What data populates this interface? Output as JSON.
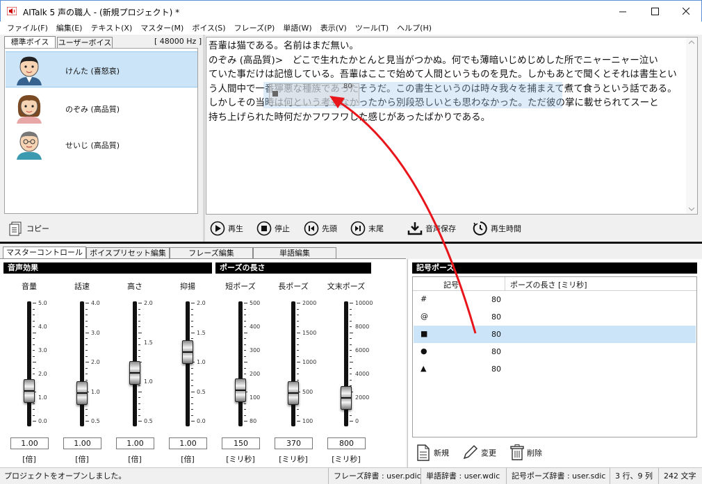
{
  "window": {
    "title": "AITalk 5 声の職人 - (新規プロジェクト) *"
  },
  "menu": [
    "ファイル(F)",
    "編集(E)",
    "テキスト(X)",
    "マスター(M)",
    "ボイス(S)",
    "フレーズ(P)",
    "単語(W)",
    "表示(V)",
    "ツール(T)",
    "ヘルプ(H)"
  ],
  "voice_panel": {
    "tabs": [
      "標準ボイス",
      "ユーザーボイス"
    ],
    "sample_rate": "[ 48000 Hz ]",
    "voices": [
      {
        "name": "けんた (喜怒哀)"
      },
      {
        "name": "のぞみ (高品質)"
      },
      {
        "name": "せいじ (高品質)"
      }
    ],
    "copy_label": "コピー"
  },
  "editor": {
    "lines": [
      "吾輩は猫である。名前はまだ無い。",
      "のぞみ (高品質)>　どこで生れたかとんと見当がつかぬ。何でも薄暗いじめじめした所でニャーニャー泣い",
      "ていた事だけは記憶している。吾輩はここで始めて人間というものを見た。しかもあとで聞くとそれは書生とい",
      "う人間中で一番獰悪な種族であったそうだ。この書生というのは時々我々を捕まえて煮て食うという話である。",
      "しかしその当時は何という考もなかったから別段恐しいとも思わなかった。ただ彼の掌に載せられてスーと",
      "持ち上げられた時何だかフワフワした感じがあったばかりである。"
    ],
    "drag_label": "80"
  },
  "playback": {
    "play": "再生",
    "stop": "停止",
    "head": "先頭",
    "tail": "末尾",
    "save": "音声保存",
    "time": "再生時間"
  },
  "lower_tabs": [
    "マスターコントロール",
    "ボイスプリセット編集",
    "フレーズ編集",
    "単語編集"
  ],
  "master": {
    "sound_effect_header": "音声効果",
    "pause_header": "ポーズの長さ",
    "sliders": [
      {
        "label": "音量",
        "value": "1.00",
        "unit": "[倍]",
        "ticks": [
          "5.0",
          "4.0",
          "3.0",
          "2.0",
          "1.0",
          "0.0"
        ]
      },
      {
        "label": "話速",
        "value": "1.00",
        "unit": "[倍]",
        "ticks": [
          "4.0",
          "3.0",
          "2.0",
          "1.0",
          "0.5"
        ]
      },
      {
        "label": "高さ",
        "value": "1.00",
        "unit": "[倍]",
        "ticks": [
          "2.0",
          "1.5",
          "1.0",
          "0.5"
        ]
      },
      {
        "label": "抑揚",
        "value": "1.00",
        "unit": "[倍]",
        "ticks": [
          "2.0",
          "1.5",
          "1.0",
          "0.5",
          "0.0"
        ]
      },
      {
        "label": "短ポーズ",
        "value": "150",
        "unit": "[ミリ秒]",
        "ticks": [
          "500",
          "400",
          "300",
          "200",
          "100",
          "80"
        ]
      },
      {
        "label": "長ポーズ",
        "value": "370",
        "unit": "[ミリ秒]",
        "ticks": [
          "2000",
          "1500",
          "1000",
          "500",
          "100"
        ]
      },
      {
        "label": "文末ポーズ",
        "value": "800",
        "unit": "[ミリ秒]",
        "ticks": [
          "10000",
          "8000",
          "6000",
          "4000",
          "2000",
          "0"
        ]
      }
    ]
  },
  "symbol_pause": {
    "header": "記号ポーズ",
    "col_symbol": "記号",
    "col_length": "ポーズの長さ [ミリ秒]",
    "rows": [
      {
        "symbol": "#",
        "value": "80"
      },
      {
        "symbol": "@",
        "value": "80"
      },
      {
        "symbol": "■",
        "value": "80"
      },
      {
        "symbol": "●",
        "value": "80"
      },
      {
        "symbol": "▲",
        "value": "80"
      }
    ],
    "new_label": "新規",
    "edit_label": "変更",
    "delete_label": "削除"
  },
  "status": {
    "message": "プロジェクトをオープンしました。",
    "phrase_dict": "フレーズ辞書 : user.pdic",
    "word_dict": "単語辞書 : user.wdic",
    "symbol_dict": "記号ポーズ辞書 : user.sdic",
    "position": "3 行、9 列",
    "chars": "242 文字"
  }
}
